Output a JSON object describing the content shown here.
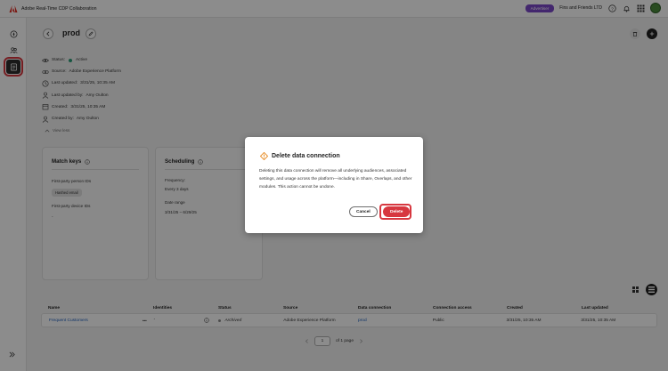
{
  "app": {
    "title": "Adobe Real-Time CDP Collaboration",
    "advertiser_badge": "Advertiser",
    "org_name": "Fins and Friends LTD"
  },
  "header": {
    "title": "prod"
  },
  "metadata": [
    {
      "icon": "eye-icon",
      "label": "Status:",
      "value": "Active"
    },
    {
      "icon": "link-icon",
      "label": "Source:",
      "value": "Adobe Experience Platform"
    },
    {
      "icon": "clock-icon",
      "label": "Last updated:",
      "value": "3/31/25, 10:35 AM"
    },
    {
      "icon": "user-icon",
      "label": "Last updated by:",
      "value": "Amy Oulton"
    },
    {
      "icon": "calendar-icon",
      "label": "Created:",
      "value": "3/31/25, 10:35 AM"
    },
    {
      "icon": "user-icon",
      "label": "Created by:",
      "value": "Amy Oulton"
    }
  ],
  "view_less": "View less",
  "match_keys": {
    "title": "Match keys",
    "first_party_person_label": "First-party person IDs",
    "hashed_email_tag": "Hashed email",
    "first_party_device_label": "First-party device IDs",
    "first_party_device_value": "-"
  },
  "scheduling": {
    "title": "Scheduling",
    "frequency_label": "Frequency:",
    "frequency_value": "Every 3 days",
    "date_range_label": "Date range",
    "date_range_value": "3/31/25 – 6/29/25"
  },
  "table": {
    "headers": [
      "Name",
      "Identities",
      "Status",
      "Source",
      "Data connection",
      "Connection access",
      "Created",
      "Last updated"
    ],
    "rows": [
      {
        "name": "Frequent Customers",
        "more": "•••",
        "identities": "-",
        "status": "Archived",
        "source": "Adobe Experience Platform",
        "data_connection": "prod",
        "connection_access": "Public",
        "created": "3/31/25, 10:35 AM",
        "last_updated": "3/31/25, 10:35 AM"
      }
    ]
  },
  "pagination": {
    "page": "1",
    "of_text": "of 1 page"
  },
  "modal": {
    "title": "Delete data connection",
    "body": "Deleting this data connection will remove all underlying audiences, associated settings, and usage across the platform—including in Share, Overlaps, and other modules. This action cannot be undone.",
    "cancel_label": "Cancel",
    "delete_label": "Delete"
  },
  "colors": {
    "accent_purple": "#7b48c9",
    "danger_red": "#d7373f",
    "link_blue": "#1d5fbf",
    "active_green": "#2d9d78",
    "warning_orange": "#e68619"
  }
}
